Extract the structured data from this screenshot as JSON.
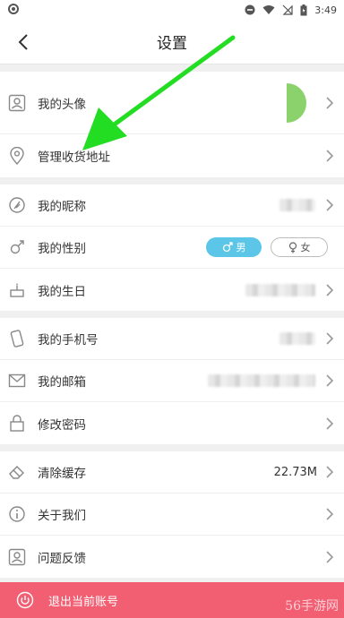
{
  "status_bar": {
    "time": "3:49"
  },
  "nav": {
    "title": "设置"
  },
  "group1": [
    {
      "label": "我的头像"
    },
    {
      "label": "管理收货地址"
    }
  ],
  "group2": [
    {
      "label": "我的昵称"
    },
    {
      "label": "我的性别",
      "male": "男",
      "female": "女"
    },
    {
      "label": "我的生日"
    }
  ],
  "group3": [
    {
      "label": "我的手机号"
    },
    {
      "label": "我的邮箱"
    },
    {
      "label": "修改密码"
    }
  ],
  "group4": [
    {
      "label": "清除缓存",
      "value": "22.73M"
    },
    {
      "label": "关于我们"
    },
    {
      "label": "问题反馈"
    }
  ],
  "logout": {
    "label": "退出当前账号"
  },
  "watermark": "56手游网",
  "colors": {
    "accent": "#f25e72",
    "male": "#5bc6e8",
    "avatar": "#8bd26d",
    "arrow": "#22dd22"
  }
}
